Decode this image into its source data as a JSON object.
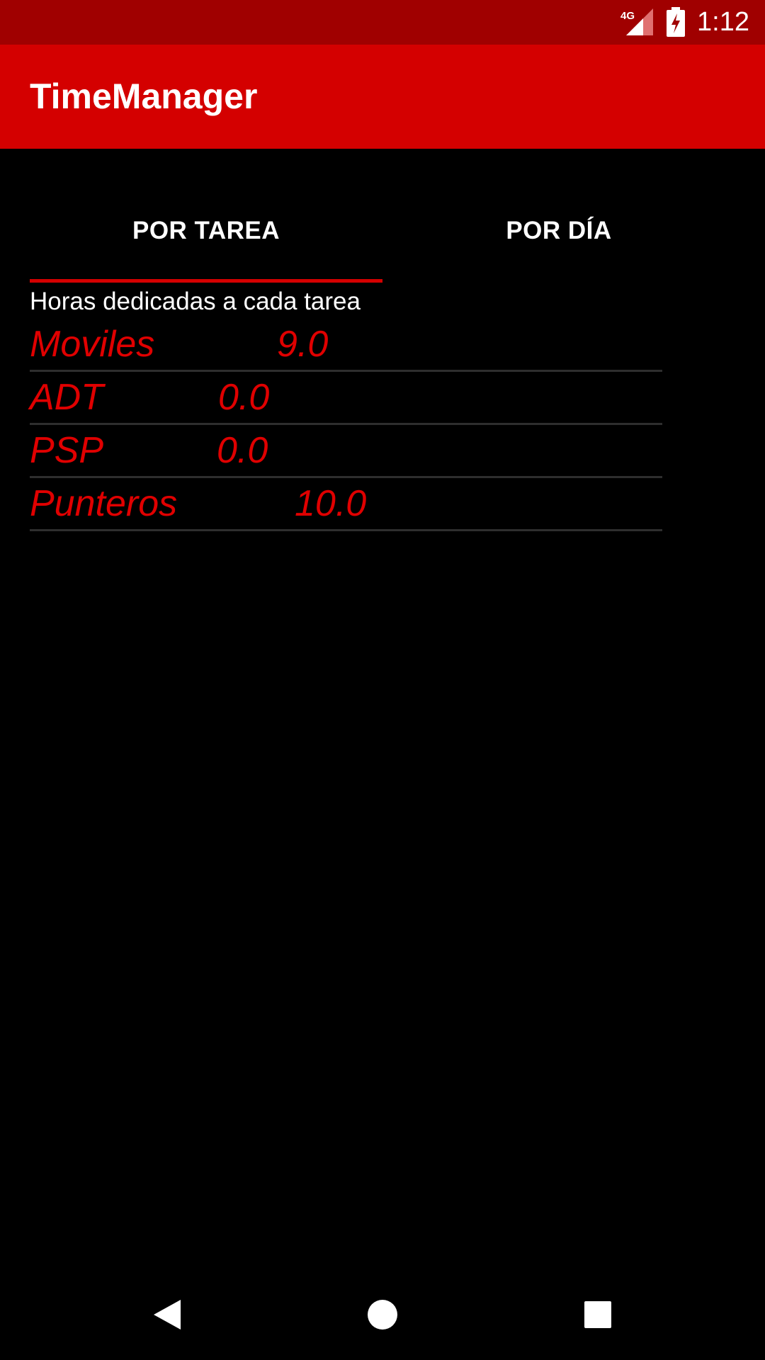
{
  "status_bar": {
    "network_label": "4G",
    "time": "1:12",
    "background": "#a00000",
    "icons": [
      "network-signal-icon",
      "battery-charging-icon"
    ]
  },
  "app_bar": {
    "title": "TimeManager",
    "background": "#d40000"
  },
  "tabs": [
    {
      "label": "POR TAREA",
      "selected": true
    },
    {
      "label": "POR DÍA",
      "selected": false
    }
  ],
  "content": {
    "subtitle": "Horas dedicadas a cada tarea",
    "tasks": [
      {
        "name": "Moviles",
        "hours": "9.0"
      },
      {
        "name": "ADT",
        "hours": "0.0"
      },
      {
        "name": "PSP",
        "hours": "0.0"
      },
      {
        "name": "Punteros",
        "hours": "10.0"
      }
    ],
    "accent_color": "#e00000"
  },
  "nav_bar": {
    "buttons": [
      "back-icon",
      "home-icon",
      "recents-icon"
    ]
  }
}
